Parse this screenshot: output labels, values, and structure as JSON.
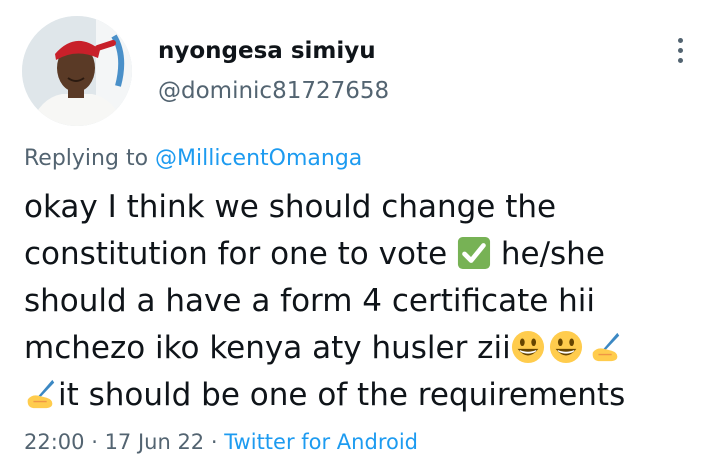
{
  "author": {
    "name": "nyongesa simiyu",
    "handle": "@dominic81727658"
  },
  "reply": {
    "prefix": "Replying to",
    "mention": "@MillicentOmanga"
  },
  "tweet": {
    "lines": {
      "l1": "okay  I think we should change the",
      "l2a": "constitution for one to vote ",
      "l2b": " he/she",
      "l3": "should a have a form 4 certificate hii",
      "l4a": "mchezo iko kenya aty husler  zii",
      "l5": "it should be one of the requirements"
    },
    "emoji_icons": [
      "check-mark-button-icon",
      "grinning-face-icon",
      "writing-hand-icon"
    ]
  },
  "meta": {
    "time": "22:00",
    "separator1": " · ",
    "date": "17 Jun 22",
    "separator2": " · ",
    "source": "Twitter for Android"
  },
  "colors": {
    "accent": "#1d9bf0",
    "secondary_text": "#536471",
    "primary_text": "#0f1419",
    "check_green": "#77b255",
    "emoji_yellow": "#ffcc4d"
  }
}
